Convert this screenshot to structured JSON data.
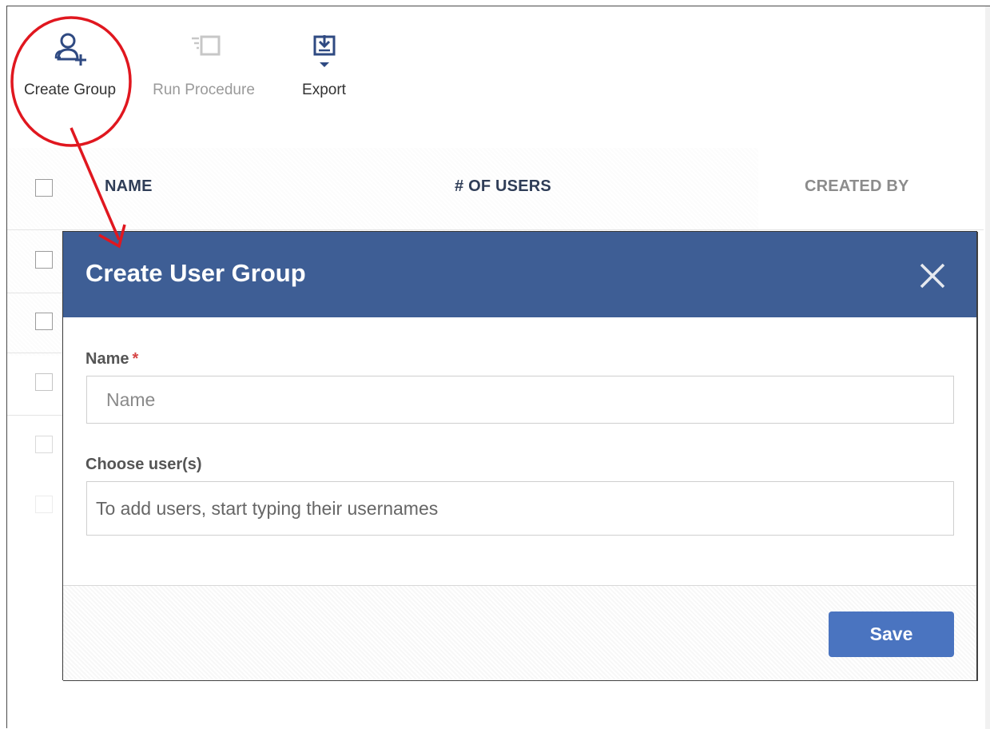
{
  "toolbar": {
    "create_group_label": "Create Group",
    "run_procedure_label": "Run Procedure",
    "export_label": "Export"
  },
  "table": {
    "columns": [
      "NAME",
      "# OF USERS",
      "CREATED BY"
    ]
  },
  "modal": {
    "title": "Create User Group",
    "name_label": "Name",
    "name_required_mark": "*",
    "name_placeholder": "Name",
    "users_label": "Choose user(s)",
    "users_placeholder": "To add users, start typing their usernames",
    "save_label": "Save"
  },
  "colors": {
    "modal_header": "#3e5e95",
    "save_button": "#4a74c0",
    "annotation": "#e0171f"
  }
}
